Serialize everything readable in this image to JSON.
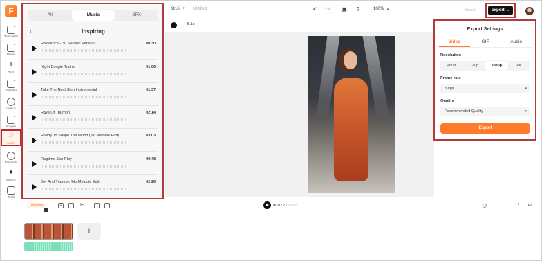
{
  "rail": {
    "items": [
      {
        "label": "Templates",
        "icon": "templates-icon"
      },
      {
        "label": "Media",
        "icon": "media-icon"
      },
      {
        "label": "Text",
        "icon": "text-icon"
      },
      {
        "label": "Subtitles",
        "icon": "subtitles-icon"
      },
      {
        "label": "Videos",
        "icon": "videos-icon"
      },
      {
        "label": "Images",
        "icon": "images-icon"
      },
      {
        "label": "Audio",
        "icon": "audio-icon"
      },
      {
        "label": "Elements",
        "icon": "elements-icon"
      },
      {
        "label": "Effects",
        "icon": "effects-icon"
      },
      {
        "label": "Tools",
        "icon": "tools-icon"
      }
    ],
    "active_index": 6,
    "logo_letter": "F"
  },
  "library": {
    "tabs": [
      "All",
      "Music",
      "SFX"
    ],
    "active_tab": "Music",
    "playlist_title": "Inspiring",
    "tracks": [
      {
        "name": "Resilience - 30 Second Version",
        "duration": "00:30"
      },
      {
        "name": "Night Boogie Trains",
        "duration": "01:06"
      },
      {
        "name": "Take The Next Step Instrumental",
        "duration": "01:37"
      },
      {
        "name": "Rays Of Triumph",
        "duration": "02:14"
      },
      {
        "name": "Ready To Shape The World (No Melodie Edit)",
        "duration": "03:03"
      },
      {
        "name": "Ragtime Son Play",
        "duration": "00:48"
      },
      {
        "name": "Joy And Triumph (No Melodie Edit)",
        "duration": "02:26"
      }
    ]
  },
  "topbar": {
    "aspect_ratio": "9:16",
    "project_title": "Untitled",
    "zoom": "100%",
    "saved_label": "Saved",
    "export_label": "Export →"
  },
  "canvas": {
    "duration_chip": "5.1s"
  },
  "export_settings": {
    "title": "Export Settings",
    "tabs": [
      "Video",
      "GIF",
      "Audio"
    ],
    "active_tab": "Video",
    "resolution_label": "Resolution",
    "resolutions": [
      "480p",
      "720p",
      "1080p",
      "4K"
    ],
    "selected_resolution": "1080p",
    "frame_rate_label": "Frame rate",
    "frame_rate_value": "30fps",
    "quality_label": "Quality",
    "quality_value": "Recommended Quality",
    "export_button": "Export"
  },
  "timeline": {
    "label": "Timeline",
    "current_time": "00:02.2",
    "total_time": "/ 00:05.1",
    "fit_label": "Fit",
    "add_label": "+"
  },
  "colors": {
    "accent": "#ff7a2a",
    "highlight_border": "#b23a3a",
    "export_bg": "#111111"
  }
}
